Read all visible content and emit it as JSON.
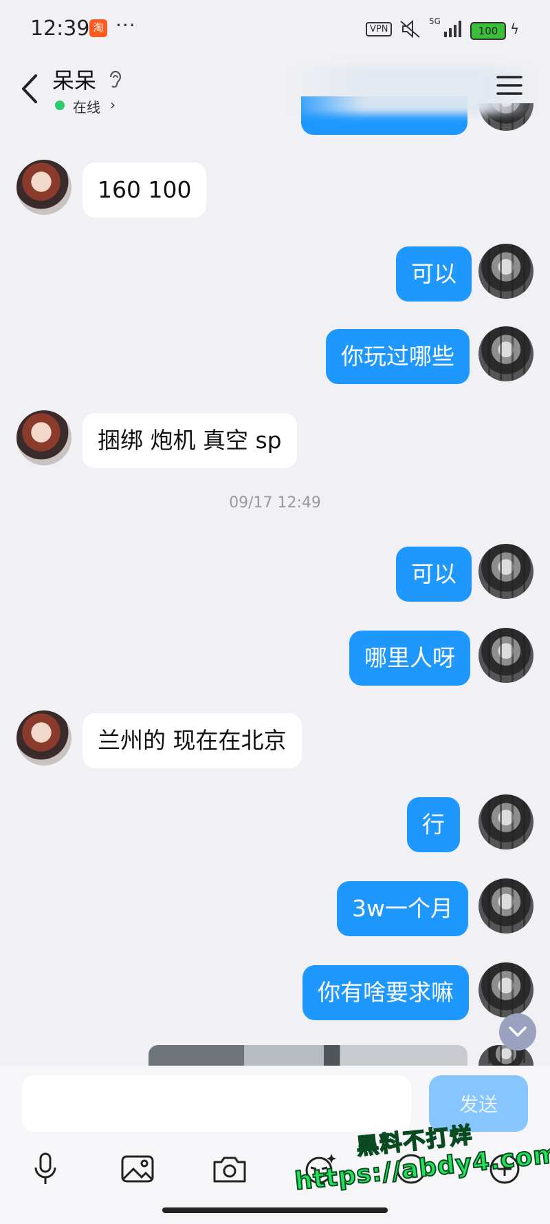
{
  "status_bar": {
    "time": "12:39",
    "taobao_icon_text": "淘",
    "more": "···",
    "vpn": "VPN",
    "network": "5G",
    "battery": "100"
  },
  "header": {
    "title": "呆呆",
    "status": "在线",
    "online_color": "#2ecc71"
  },
  "messages": [
    {
      "side": "in",
      "text": "160 100"
    },
    {
      "side": "out",
      "text": "可以"
    },
    {
      "side": "out",
      "text": "你玩过哪些"
    },
    {
      "side": "in",
      "text": "捆绑 炮机 真空 sp"
    },
    {
      "type": "timestamp",
      "text": "09/17 12:49"
    },
    {
      "side": "out",
      "text": "可以"
    },
    {
      "side": "out",
      "text": "哪里人呀"
    },
    {
      "side": "in",
      "text": "兰州的 现在在北京"
    },
    {
      "side": "out",
      "text": "行"
    },
    {
      "side": "out",
      "text": "3w一个月"
    },
    {
      "side": "out",
      "text": "你有啥要求嘛"
    }
  ],
  "composer": {
    "input_value": "",
    "send_label": "发送",
    "tools": [
      "microphone-icon",
      "image-icon",
      "camera-icon",
      "sticker-icon",
      "add-icon"
    ]
  },
  "watermark": {
    "line1": "黑料不打烊",
    "line2": "https://abdy4.com"
  },
  "colors": {
    "outgoing_bubble": "#1e98ff",
    "incoming_bubble": "#ffffff",
    "background": "#f1f1f5",
    "send_button": "#86c5ff"
  }
}
